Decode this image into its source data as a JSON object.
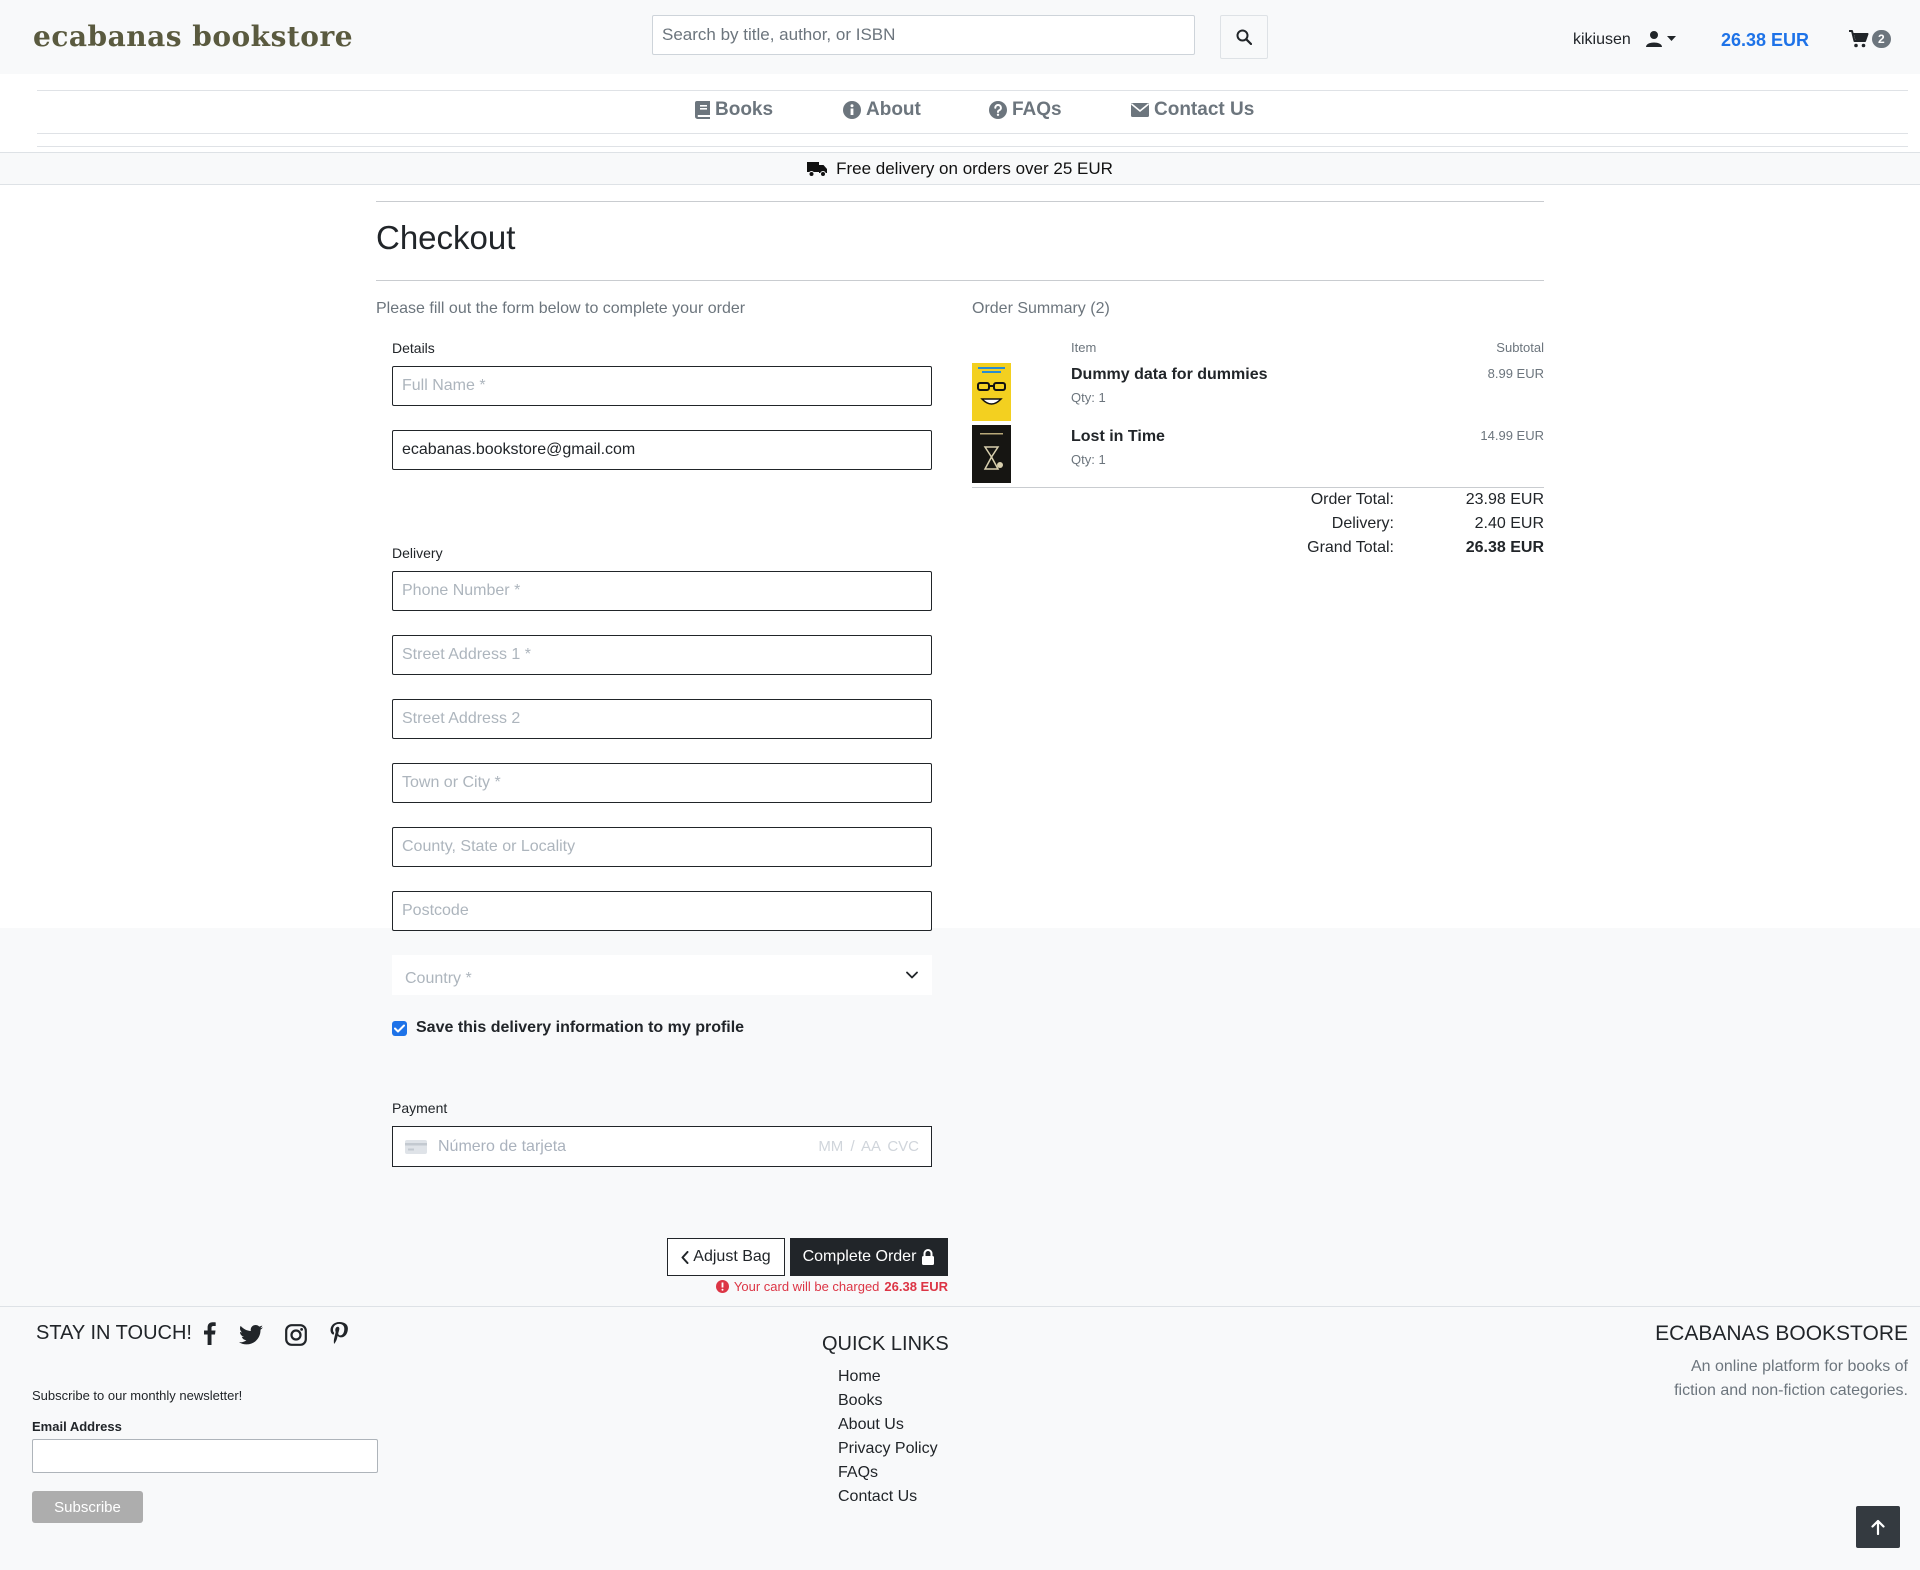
{
  "header": {
    "logo": "ecabanas bookstore",
    "search_placeholder": "Search by title, author, or ISBN",
    "username": "kikiusen",
    "total": "26.38 EUR",
    "cart_count": "2",
    "accent_color": "#1e73e8"
  },
  "nav": {
    "items": [
      {
        "label": "Books",
        "icon": "book-icon"
      },
      {
        "label": "About",
        "icon": "info-circle-icon"
      },
      {
        "label": "FAQs",
        "icon": "question-circle-icon"
      },
      {
        "label": "Contact Us",
        "icon": "envelope-icon"
      }
    ]
  },
  "banner": {
    "text": "Free delivery on orders over 25 EUR",
    "icon": "truck-icon"
  },
  "checkout": {
    "title": "Checkout",
    "intro": "Please fill out the form below to complete your order",
    "details_legend": "Details",
    "full_name_placeholder": "Full Name *",
    "email_value": "ecabanas.bookstore@gmail.com",
    "delivery_legend": "Delivery",
    "phone_placeholder": "Phone Number *",
    "street1_placeholder": "Street Address 1 *",
    "street2_placeholder": "Street Address 2",
    "town_placeholder": "Town or City *",
    "county_placeholder": "County, State or Locality",
    "postcode_placeholder": "Postcode",
    "country_placeholder": "Country *",
    "save_label": "Save this delivery information to my profile",
    "save_checked": true,
    "payment_legend": "Payment",
    "card_placeholder": "Número de tarjeta",
    "card_expiry_cvc": "MM / AA  CVC",
    "adjust_label": "Adjust Bag",
    "complete_label": "Complete Order",
    "charge_text": "Your card will be charged",
    "charge_amount": "26.38 EUR",
    "error_color": "#dc3545"
  },
  "summary": {
    "title": "Order Summary (2)",
    "col_item": "Item",
    "col_subtotal": "Subtotal",
    "items": [
      {
        "title": "Dummy data for dummies",
        "qty": "Qty: 1",
        "subtotal": "8.99 EUR"
      },
      {
        "title": "Lost in Time",
        "qty": "Qty: 1",
        "subtotal": "14.99 EUR"
      }
    ],
    "order_total_label": "Order Total:",
    "order_total": "23.98 EUR",
    "delivery_label": "Delivery:",
    "delivery": "2.40 EUR",
    "grand_total_label": "Grand Total:",
    "grand_total": "26.38 EUR"
  },
  "footer": {
    "stay_title": "STAY IN TOUCH!",
    "newsletter_text": "Subscribe to our monthly newsletter!",
    "email_label": "Email Address",
    "subscribe_label": "Subscribe",
    "quick_links_title": "QUICK LINKS",
    "quick_links": [
      "Home",
      "Books",
      "About Us",
      "Privacy Policy",
      "FAQs",
      "Contact Us"
    ],
    "brand_title": "ECABANAS BOOKSTORE",
    "brand_desc": "An online platform for books of fiction and non-fiction categories."
  }
}
